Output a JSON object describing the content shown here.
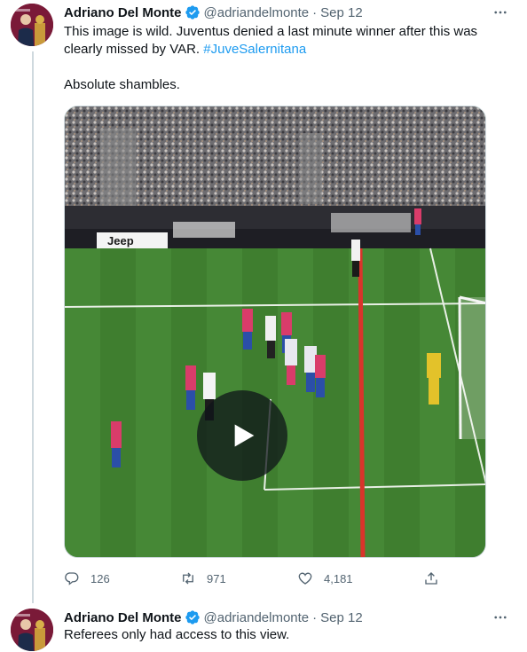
{
  "tweets": [
    {
      "author_name": "Adriano Del Monte",
      "handle": "@adriandelmonte",
      "separator": "·",
      "date": "Sep 12",
      "text_line1": "This image is wild. Juventus denied a last minute winner after this was clearly missed by VAR. ",
      "hashtag": "#JuveSalernitana",
      "text_para2": "Absolute shambles.",
      "media_banner": "Jeep",
      "actions": {
        "replies": "126",
        "retweets": "971",
        "likes": "4,181"
      }
    },
    {
      "author_name": "Adriano Del Monte",
      "handle": "@adriandelmonte",
      "separator": "·",
      "date": "Sep 12",
      "text": "Referees only had access to this view."
    }
  ],
  "icons": {
    "verified": "verified-badge-icon",
    "more": "more-horizontal-icon",
    "reply": "reply-icon",
    "retweet": "retweet-icon",
    "like": "like-icon",
    "share": "share-icon",
    "play": "play-icon"
  },
  "colors": {
    "verified": "#1d9bf0",
    "hashtag": "#1d9bf0",
    "secondary_text": "#536471",
    "offside_line": "#d9342b",
    "pitch": "#3d7a2e"
  }
}
